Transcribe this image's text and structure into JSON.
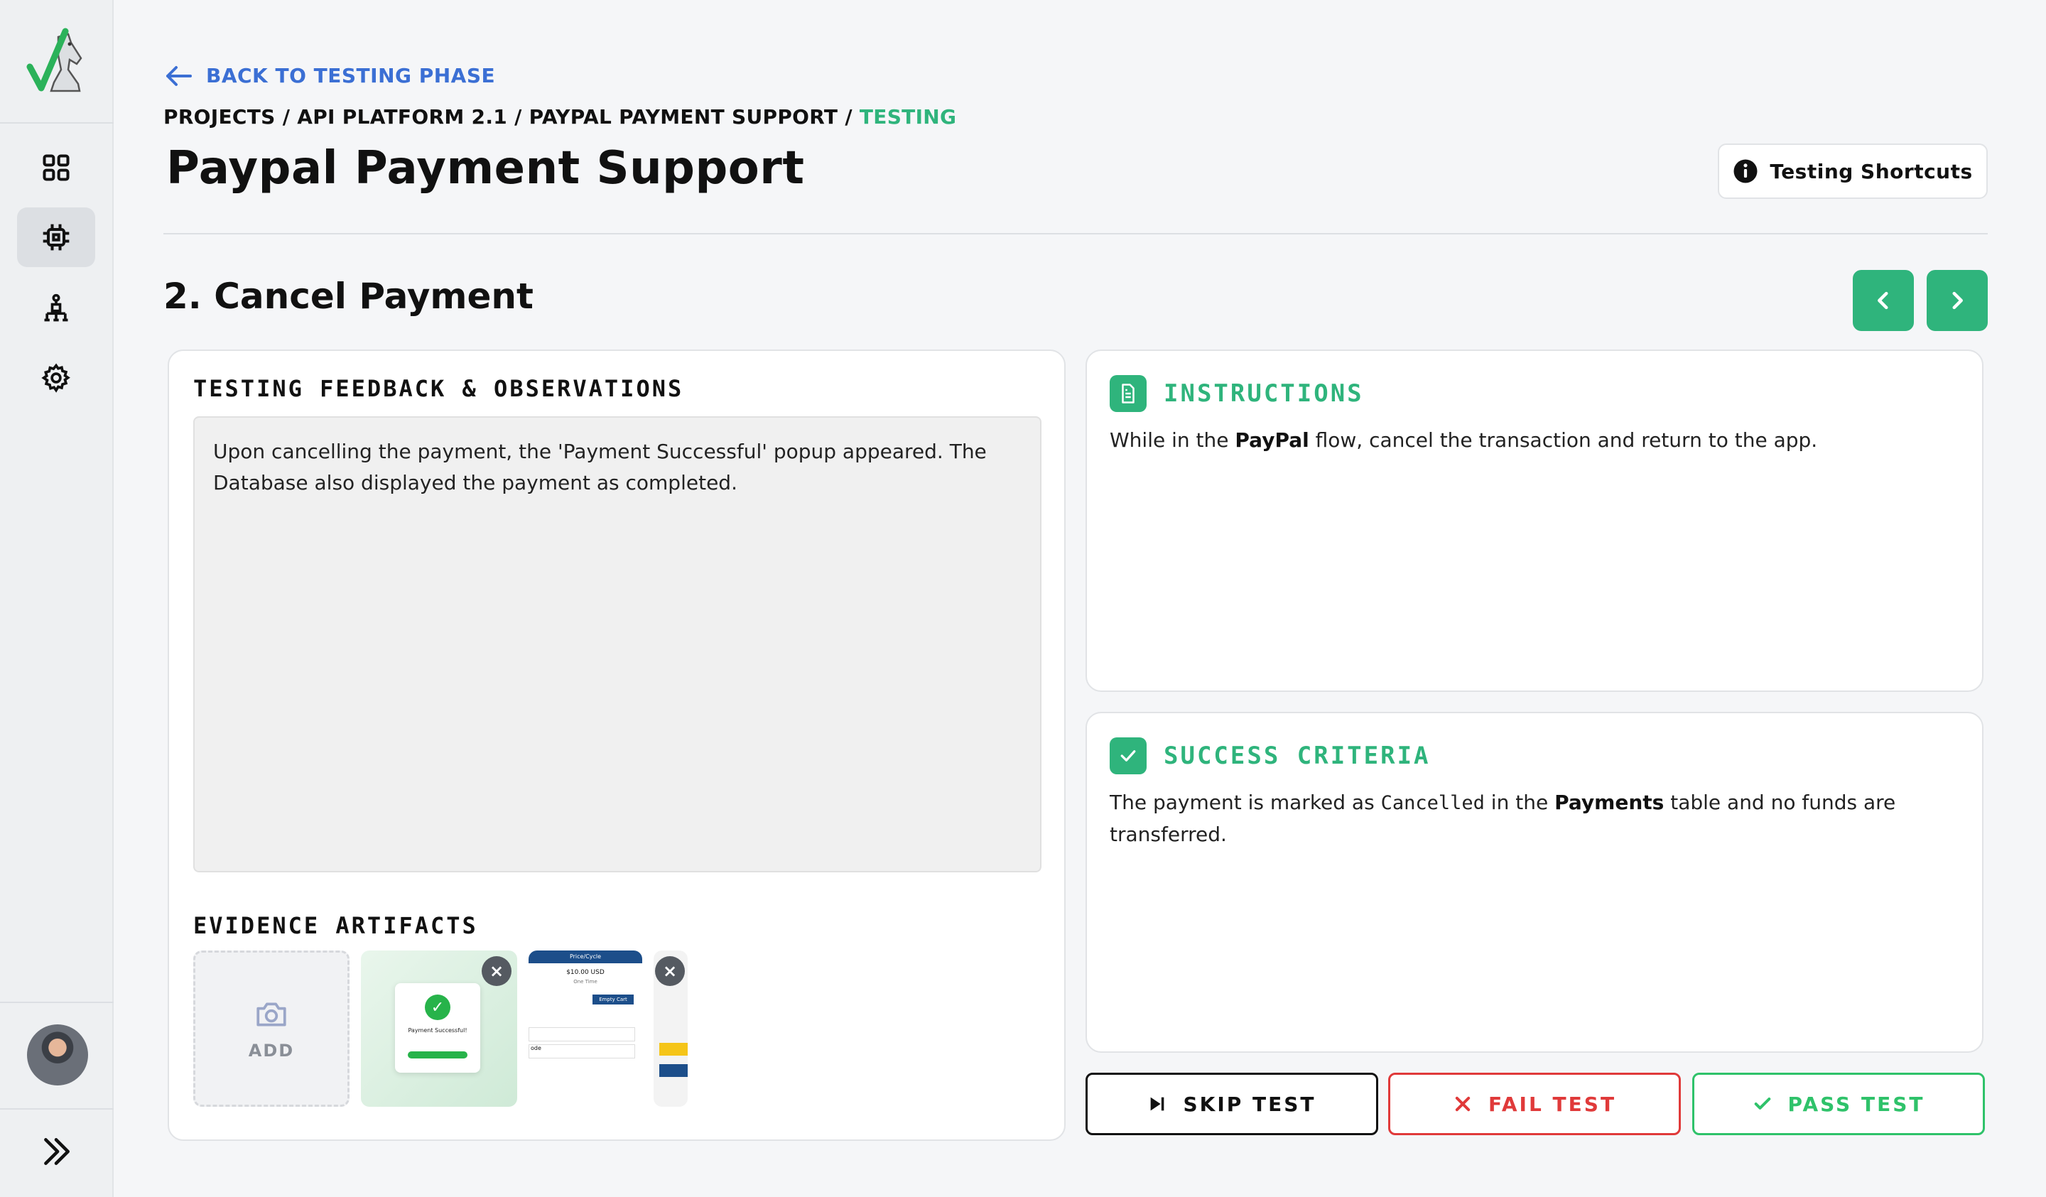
{
  "colors": {
    "accent": "#2fb47c",
    "link": "#3b6fd4",
    "fail": "#e03a3a",
    "pass": "#2fc26a"
  },
  "sidebar": {
    "items": [
      {
        "name": "dashboard",
        "icon": "grid-icon",
        "active": false
      },
      {
        "name": "chip",
        "icon": "chip-icon",
        "active": true
      },
      {
        "name": "hierarchy",
        "icon": "org-chart-icon",
        "active": false
      },
      {
        "name": "settings",
        "icon": "gear-icon",
        "active": false
      }
    ],
    "expand_icon": "double-chevron-right-icon"
  },
  "header": {
    "back_label": "BACK TO TESTING PHASE",
    "breadcrumb": [
      "PROJECTS /",
      "API PLATFORM 2.1 /",
      "PAYPAL PAYMENT SUPPORT /",
      "TESTING"
    ],
    "title": "Paypal Payment Support",
    "shortcuts_label": "Testing Shortcuts"
  },
  "test": {
    "title": "2. Cancel Payment"
  },
  "feedback": {
    "heading": "TESTING FEEDBACK & OBSERVATIONS",
    "text": "Upon cancelling the payment, the 'Payment Successful' popup appeared. The Database also displayed the payment as completed."
  },
  "artifacts": {
    "heading": "EVIDENCE ARTIFACTS",
    "add_label": "ADD",
    "thumb1": {
      "caption": "Payment Successful!"
    },
    "thumb2": {
      "header": "Price/Cycle",
      "price": "$10.00 USD",
      "sub": "One Time",
      "button": "Empty Cart",
      "field": "ode"
    }
  },
  "instructions": {
    "heading": "INSTRUCTIONS",
    "text_before": "While in the ",
    "text_bold": "PayPal",
    "text_after": " flow, cancel the transaction and return to the app."
  },
  "success": {
    "heading": "SUCCESS CRITERIA",
    "t1": "The payment is marked as ",
    "code": "Cancelled",
    "t2": " in the ",
    "bold": "Payments",
    "t3": " table and no funds are transferred."
  },
  "actions": {
    "skip": "SKIP TEST",
    "fail": "FAIL TEST",
    "pass": "PASS TEST"
  }
}
